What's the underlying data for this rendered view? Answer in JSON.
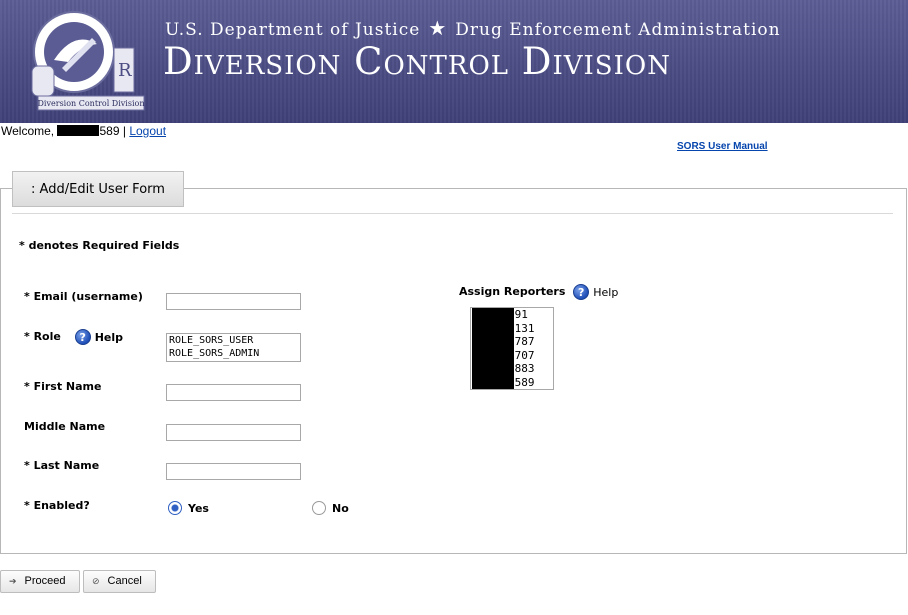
{
  "header": {
    "line1_left": "U.S. Department of Justice",
    "line1_right": "Drug Enforcement Administration",
    "title": "Diversion Control Division",
    "seal_caption": "Diversion Control Division",
    "seal_ring_text": "U.S. Department of Justice · Drug Enforcement Administration"
  },
  "session": {
    "welcome_prefix": "Welcome,",
    "username_suffix": "589",
    "separator": "|",
    "logout_label": "Logout",
    "manual_label": "SORS User Manual"
  },
  "form": {
    "tab_label": ": Add/Edit User Form",
    "required_note": "* denotes Required Fields",
    "email_label": "* Email (username)",
    "email_value": "",
    "role_label": "* Role",
    "role_help": "Help",
    "role_options": [
      "ROLE_SORS_USER",
      "ROLE_SORS_ADMIN"
    ],
    "first_name_label": "* First Name",
    "first_name_value": "",
    "middle_name_label": "Middle Name",
    "middle_name_value": "",
    "last_name_label": "* Last Name",
    "last_name_value": "",
    "enabled_label": "* Enabled?",
    "enabled_yes": "Yes",
    "enabled_no": "No",
    "enabled_selected": "Yes",
    "reporters_label": "Assign Reporters",
    "reporters_help": "Help",
    "reporters_visible_suffixes": [
      "691",
      "3131",
      "3787",
      "3707",
      "0883",
      "3589"
    ]
  },
  "buttons": {
    "proceed_label": "Proceed",
    "cancel_label": "Cancel"
  },
  "colors": {
    "banner": "#4b4d84",
    "link": "#0645ad",
    "help_icon": "#1f4fb8"
  },
  "icons": {
    "help": "question-circle-icon",
    "proceed": "arrow-right-icon",
    "cancel": "no-entry-icon"
  }
}
